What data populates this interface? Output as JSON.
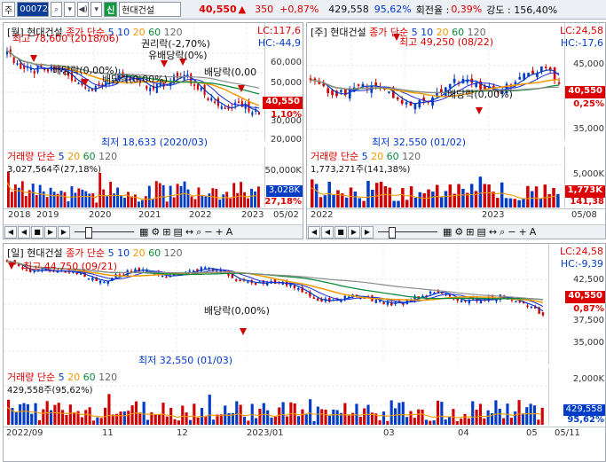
{
  "toolbar": {
    "market": "주",
    "code": "000720",
    "search_icon": "search-icon",
    "sound_icon": "speaker-icon",
    "credit": "신",
    "name": "현대건설",
    "price": "40,550",
    "arrow": "▲",
    "change": "350",
    "change_pct": "+0,87%",
    "volume": "429,558",
    "ratio": "95,62%",
    "turnover_label": "회전율 :",
    "turnover": "0,39%",
    "strength": "강도 : 156,40%"
  },
  "colors": {
    "red": "#d00000",
    "blue": "#003cc6",
    "orange": "#f29a00",
    "green": "#0b8a39",
    "gray": "#8c8c8c"
  },
  "weekly": {
    "title": "[월] 현대건설",
    "indicator": "종가 단순",
    "periods": [
      "5",
      "10",
      "20",
      "60",
      "120"
    ],
    "lc": "LC:117,6",
    "hc": "HC:-44,9",
    "price_tag": "40,550",
    "pct_tag": "1,10%",
    "yaxis": [
      "60,000",
      "50,000",
      "40,000",
      "30,000",
      "20,000"
    ],
    "annotations": {
      "dividend_1": "배당락(0,00%)",
      "dividend_2": "배당락(0,00%)",
      "rights": "권리락(-2,70%)",
      "dividend_3": "유배당락(0%)",
      "dividend_4": "배당락(0,00",
      "high": "최고 78,600 (2018/06)",
      "low": "최저 18,633 (2020/03)"
    },
    "volume_title": "거래량 단순",
    "volume_periods": [
      "5",
      "20",
      "60",
      "120"
    ],
    "volume_value": "3,027,564주(27,18%)",
    "volume_axis": "50,000K",
    "volume_tag": "3,028K",
    "volume_pct": "27,18%",
    "xaxis": [
      "2018",
      "2019",
      "2020",
      "2021",
      "2022",
      "2023",
      "05/02"
    ]
  },
  "daily_top": {
    "title": "[주] 현대건설",
    "indicator": "종가 단순",
    "periods": [
      "5",
      "10",
      "20",
      "60",
      "120"
    ],
    "lc": "LC:24,58",
    "hc": "HC:-17,6",
    "price_tag": "40,550",
    "pct_tag": "0,25%",
    "yaxis": [
      "45,000",
      "35,000"
    ],
    "annotations": {
      "high": "최고 49,250 (08/22)",
      "dividend": "배당락(0,00%)",
      "low": "최저 32,550 (01/02)"
    },
    "volume_title": "거래량 단순",
    "volume_periods": [
      "5",
      "20",
      "60",
      "120"
    ],
    "volume_value": "1,773,271주(141,38%)",
    "volume_axis": "5,000K",
    "volume_tag": "1,773K",
    "volume_pct": "141,38",
    "xaxis": [
      "2022",
      "2023",
      "05/08"
    ]
  },
  "daily": {
    "title": "[일] 현대건설",
    "indicator": "종가 단순",
    "periods": [
      "5",
      "10",
      "20",
      "60",
      "120"
    ],
    "lc": "LC:24,58",
    "hc": "HC:-9,39",
    "price_tag": "40,550",
    "pct_tag": "0,87%",
    "yaxis": [
      "42,500",
      "40,000",
      "37,500",
      "35,000"
    ],
    "annotations": {
      "high": "최고 44,750 (09/21)",
      "dividend": "배당락(0,00%)",
      "low": "최저 32,550 (01/03)"
    },
    "volume_title": "거래량 단순",
    "volume_periods": [
      "5",
      "20",
      "60",
      "120"
    ],
    "volume_value": "429,558주(95,62%)",
    "volume_axis": "2,000K",
    "volume_tag": "429,558",
    "volume_pct": "95,62%",
    "xaxis": [
      "2022/09",
      "11",
      "12",
      "2023/01",
      "03",
      "04",
      "05",
      "05/11"
    ]
  },
  "controls": {
    "first": "◀",
    "prev": "◀",
    "stop": "■",
    "next": "▶",
    "last": "▶",
    "zoom_out": "−",
    "zoom_in": "+",
    "auto": "A"
  }
}
